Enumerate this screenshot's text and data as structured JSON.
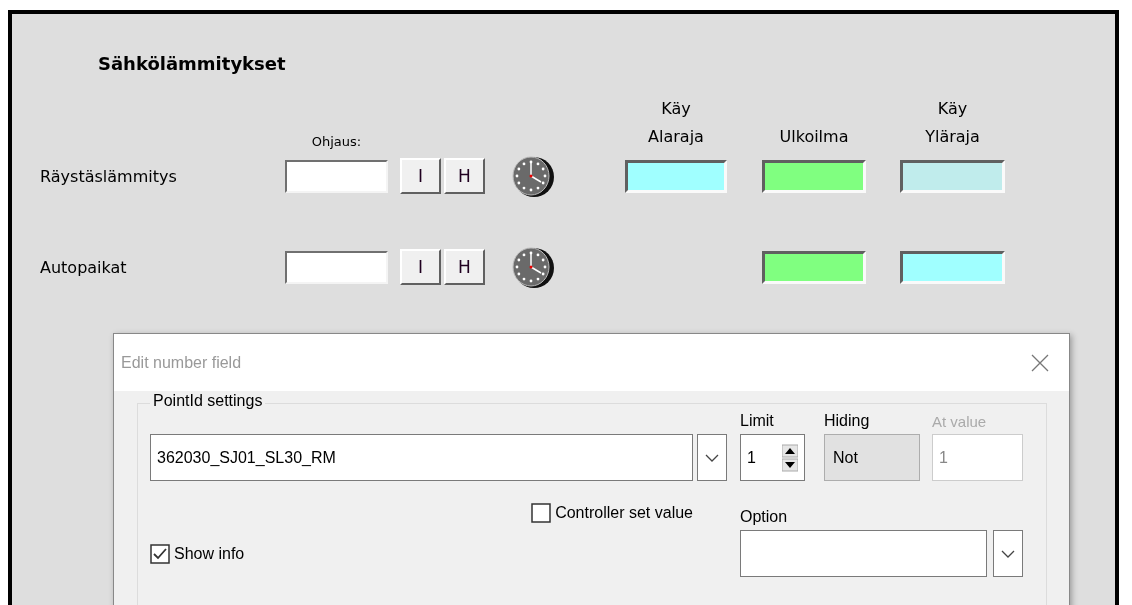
{
  "panel": {
    "title": "Sähkölämmitykset",
    "control_header": "Ohjaus:",
    "columns": [
      {
        "top": "Käy",
        "bottom": "Alaraja"
      },
      {
        "bottom": "Ulkoilma"
      },
      {
        "top": "Käy",
        "bottom": "Yläraja"
      }
    ],
    "rows": [
      {
        "label": "Räystäslämmitys",
        "buttons": [
          "I",
          "H"
        ],
        "indicators": [
          {
            "kind": "indicator",
            "color": "#a0ffff"
          },
          {
            "kind": "indicator",
            "color": "#80ff80"
          },
          {
            "kind": "indicator",
            "color": "#c0ecec"
          }
        ]
      },
      {
        "label": "Autopaikat",
        "buttons": [
          "I",
          "H"
        ],
        "indicators": [
          {
            "kind": "empty"
          },
          {
            "kind": "indicator",
            "color": "#80ff80"
          },
          {
            "kind": "indicator",
            "color": "#a0ffff"
          }
        ]
      }
    ]
  },
  "dialog": {
    "title": "Edit number field",
    "group": "PointId settings",
    "point_id": {
      "value": "362030_SJ01_SL30_RM"
    },
    "limit": {
      "label": "Limit",
      "value": "1"
    },
    "hiding": {
      "label": "Hiding",
      "value": "Not"
    },
    "at_value": {
      "label": "At value",
      "value": "1",
      "disabled": true
    },
    "controller_set_value": {
      "label": "Controller set value",
      "checked": false
    },
    "option": {
      "label": "Option"
    },
    "show_info": {
      "label": "Show info",
      "checked": true
    }
  }
}
